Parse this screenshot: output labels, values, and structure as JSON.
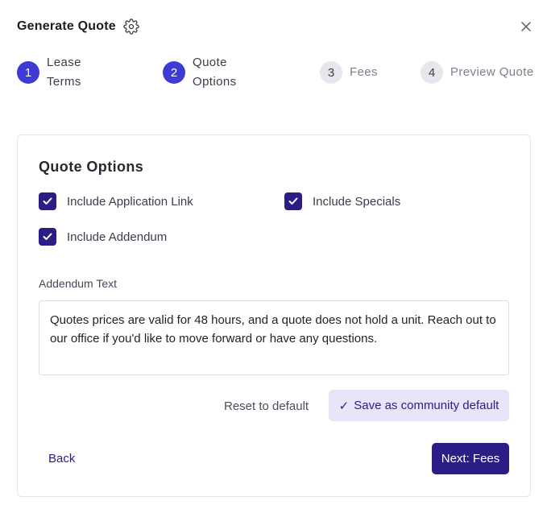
{
  "header": {
    "title": "Generate Quote",
    "settings_icon": "gear-icon",
    "close_icon": "close-icon"
  },
  "steps": [
    {
      "number": "1",
      "label": "Lease Terms",
      "state": "active"
    },
    {
      "number": "2",
      "label": "Quote Options",
      "state": "active"
    },
    {
      "number": "3",
      "label": "Fees",
      "state": "inactive"
    },
    {
      "number": "4",
      "label": "Preview Quote",
      "state": "inactive"
    }
  ],
  "quote_options": {
    "title": "Quote Options",
    "checkboxes": [
      {
        "label": "Include Application Link",
        "checked": true
      },
      {
        "label": "Include Specials",
        "checked": true
      },
      {
        "label": "Include Addendum",
        "checked": true
      }
    ],
    "addendum_label": "Addendum Text",
    "addendum_text": "Quotes prices are valid for 48 hours, and a quote does not hold a unit. Reach out to our office if you'd like to move forward or have any questions.",
    "reset_label": "Reset to default",
    "save_tick": "✓",
    "save_label": "Save as community default"
  },
  "footer": {
    "back_label": "Back",
    "next_label": "Next: Fees"
  },
  "colors": {
    "primary": "#2a1d86",
    "step_active": "#3d3bd3",
    "step_inactive": "#e6e7ec",
    "save_bg": "#e8e5fb"
  }
}
